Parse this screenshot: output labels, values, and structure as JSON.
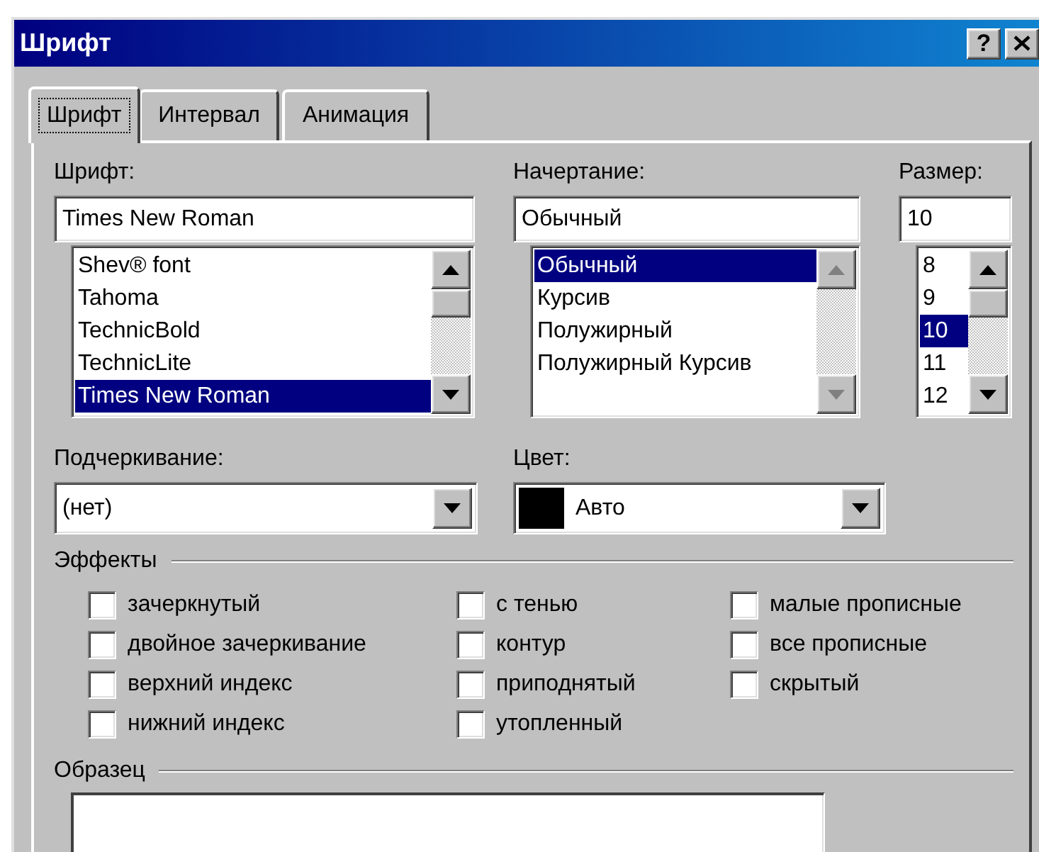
{
  "window": {
    "title": "Шрифт",
    "help": "?"
  },
  "tabs": [
    {
      "label": "Шрифт",
      "selected": true
    },
    {
      "label": "Интервал",
      "selected": false
    },
    {
      "label": "Анимация",
      "selected": false
    }
  ],
  "font": {
    "label": "Шрифт:",
    "value": "Times New Roman",
    "scroll_disabled": false,
    "items": [
      {
        "text": "Shev® font",
        "selected": false
      },
      {
        "text": "Tahoma",
        "selected": false
      },
      {
        "text": "TechnicBold",
        "selected": false
      },
      {
        "text": "TechnicLite",
        "selected": false
      },
      {
        "text": "Times New Roman",
        "selected": true
      }
    ]
  },
  "style": {
    "label": "Начертание:",
    "value": "Обычный",
    "scroll_disabled": true,
    "items": [
      {
        "text": "Обычный",
        "selected": true
      },
      {
        "text": "Курсив",
        "selected": false
      },
      {
        "text": "Полужирный",
        "selected": false
      },
      {
        "text": "Полужирный Курсив",
        "selected": false
      }
    ]
  },
  "size": {
    "label": "Размер:",
    "value": "10",
    "scroll_disabled": false,
    "items": [
      {
        "text": "8",
        "selected": false
      },
      {
        "text": "9",
        "selected": false
      },
      {
        "text": "10",
        "selected": true
      },
      {
        "text": "11",
        "selected": false
      },
      {
        "text": "12",
        "selected": false
      }
    ]
  },
  "underline": {
    "label": "Подчеркивание:",
    "value": "(нет)"
  },
  "color": {
    "label": "Цвет:",
    "value": "Авто"
  },
  "effects": {
    "label": "Эффекты",
    "options": [
      {
        "label": "зачеркнутый",
        "checked": false
      },
      {
        "label": "двойное зачеркивание",
        "checked": false
      },
      {
        "label": "верхний индекс",
        "checked": false
      },
      {
        "label": "нижний индекс",
        "checked": false
      },
      {
        "label": "с тенью",
        "checked": false
      },
      {
        "label": "контур",
        "checked": false
      },
      {
        "label": "приподнятый",
        "checked": false
      },
      {
        "label": "утопленный",
        "checked": false
      },
      {
        "label": "малые прописные",
        "checked": false
      },
      {
        "label": "все прописные",
        "checked": false
      },
      {
        "label": "скрытый",
        "checked": false
      }
    ]
  },
  "sample": {
    "label": "Образец"
  }
}
